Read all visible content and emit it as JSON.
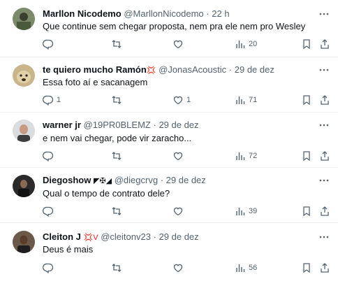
{
  "tweets": [
    {
      "name": "Marllon Nicodemo",
      "badge": "",
      "handle": "@MarllonNicodemo",
      "time": "22 h",
      "text": "Que continue sem chegar proposta, nem pra ele nem pro Wesley",
      "replies": "",
      "retweets": "",
      "likes": "",
      "views": "20"
    },
    {
      "name": "te quiero mucho Ramón",
      "badge": "💢",
      "handle": "@JonasAcoustic",
      "time": "29 de dez",
      "text": "Essa foto aí e sacanagem",
      "replies": "1",
      "retweets": "",
      "likes": "1",
      "views": "71"
    },
    {
      "name": "warner jr",
      "badge": "",
      "handle": "@19PR0BLEMZ",
      "time": "29 de dez",
      "text": "e nem vai chegar, pode vir zaracho...",
      "replies": "",
      "retweets": "",
      "likes": "",
      "views": "72"
    },
    {
      "name": "Diegoshow",
      "badge": "◤✠◢",
      "handle": "@diegcrvg",
      "time": "29 de dez",
      "text": "Qual o tempo de contrato dele?",
      "replies": "",
      "retweets": "",
      "likes": "",
      "views": "39"
    },
    {
      "name": "Cleiton J",
      "badge": "💢V",
      "handle": "@cleitonv23",
      "time": "29 de dez",
      "text": "Deus é mais",
      "replies": "",
      "retweets": "",
      "likes": "",
      "views": "56"
    }
  ],
  "separator": "·",
  "colors": {
    "text": "#0f1419",
    "secondary": "#536471",
    "border": "#eff3f4",
    "badge": "#f4212e"
  },
  "icons": [
    "reply-icon",
    "retweet-icon",
    "like-icon",
    "views-icon",
    "bookmark-icon",
    "share-icon",
    "more-icon"
  ]
}
